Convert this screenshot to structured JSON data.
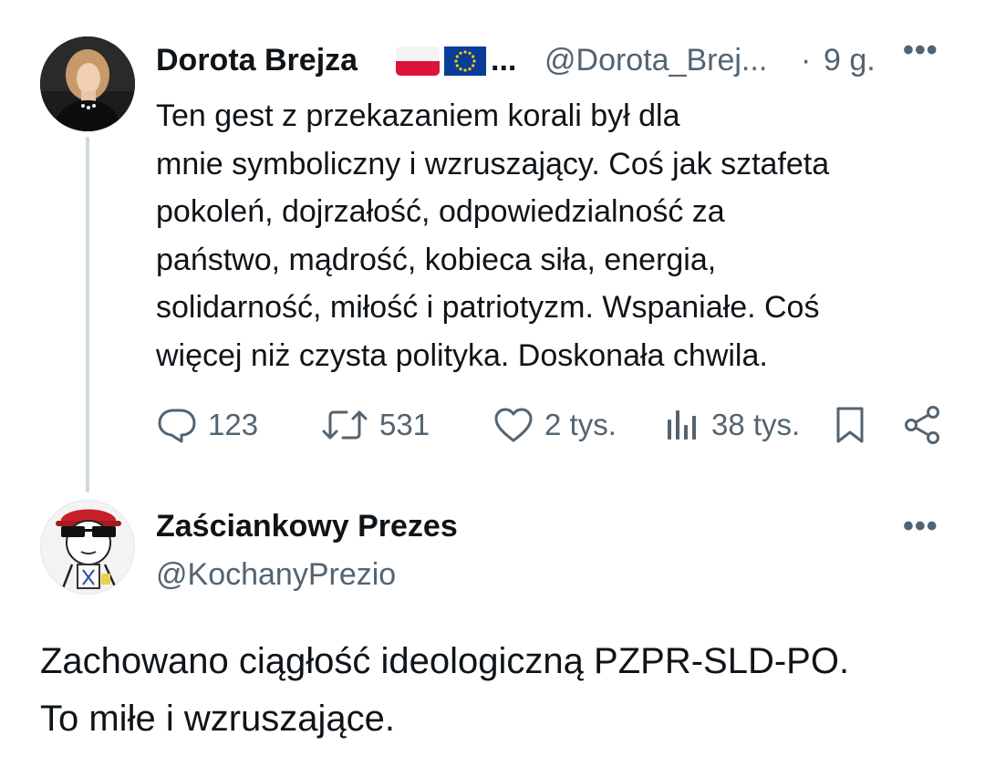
{
  "parent_tweet": {
    "author_name": "Dorota Brejza",
    "name_ellipsis": "...",
    "handle": "@Dorota_Brej...",
    "separator": "·",
    "time": "9 g.",
    "more_label": "•••",
    "text": "Ten gest z przekazaniem korali był dla\nmnie symboliczny i wzruszający. Coś jak sztafeta\npokoleń, dojrzałość, odpowiedzialność za\npaństwo, mądrość, kobieca siła, energia,\nsolidarność, miłość i patriotyzm. Wspaniałe. Coś\nwięcej niż czysta polityka. Doskonała chwila.",
    "actions": {
      "replies": "123",
      "retweets": "531",
      "likes": "2 tys.",
      "views": "38 tys."
    },
    "flags": [
      "flag-poland",
      "flag-eu"
    ]
  },
  "reply_tweet": {
    "author_name": "Zaściankowy Prezes",
    "handle": "@KochanyPrezio",
    "more_label": "•••",
    "text": "Zachowano ciągłość ideologiczną PZPR-SLD-PO.\nTo miłe i wzruszające."
  },
  "colors": {
    "text_primary": "#0f1419",
    "text_secondary": "#536471",
    "thread_line": "#cfd9de",
    "flag_red": "#dc143c",
    "eu_blue": "#0a3d99",
    "eu_star": "#ffcc00"
  },
  "icons": [
    "reply-icon",
    "retweet-icon",
    "like-icon",
    "views-icon",
    "bookmark-icon",
    "share-icon",
    "more-icon"
  ]
}
